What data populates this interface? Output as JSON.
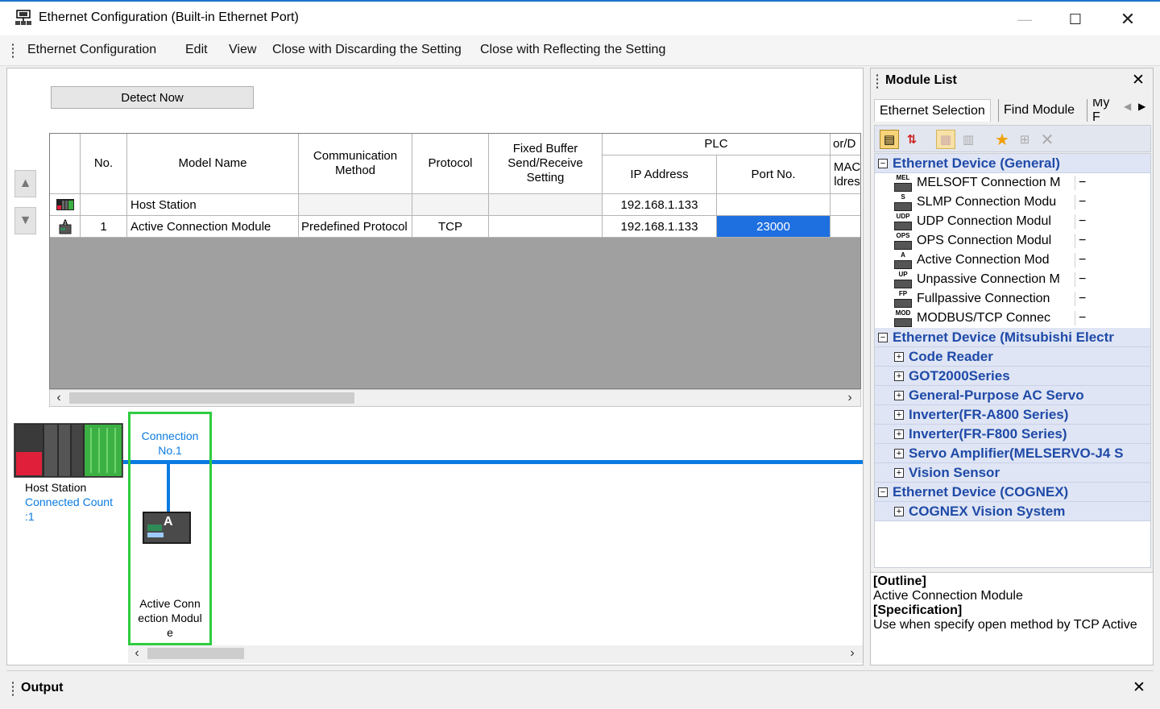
{
  "window": {
    "title": "Ethernet Configuration (Built-in Ethernet Port)",
    "minimize": "—",
    "maximize": "☐",
    "close": "✕"
  },
  "menu": [
    "Ethernet Configuration",
    "Edit",
    "View",
    "Close with Discarding the Setting",
    "Close with Reflecting the Setting"
  ],
  "toolbar": {
    "detect_label": "Detect Now"
  },
  "grid": {
    "headers": {
      "no": "No.",
      "model_name": "Model Name",
      "comm_method": "Communication Method",
      "protocol": "Protocol",
      "fixed_buffer": "Fixed Buffer Send/Receive Setting",
      "plc": "PLC",
      "ip_address": "IP Address",
      "port_no": "Port No.",
      "extra_top": "or/D",
      "extra_bottom": "MAC ldres"
    },
    "rows": [
      {
        "no": "",
        "model_name": "Host Station",
        "comm_method": "",
        "protocol": "",
        "fixed_buffer": "",
        "ip_address": "192.168.1.133",
        "port_no": ""
      },
      {
        "no": "1",
        "model_name": "Active Connection Module",
        "comm_method": "Predefined Protocol",
        "protocol": "TCP",
        "fixed_buffer": "",
        "ip_address": "192.168.1.133",
        "port_no": "23000"
      }
    ]
  },
  "diagram": {
    "host_label": "Host Station",
    "connected_count_label": "Connected Count",
    "connected_count_value": ":1",
    "connection_label": "Connection",
    "connection_no": "No.1",
    "module_label_1": "Active Conn",
    "module_label_2": "ection Modul",
    "module_label_3": "e",
    "module_glyph": "A"
  },
  "module_list": {
    "title": "Module List",
    "tabs": [
      "Ethernet Selection",
      "Find Module",
      "My F"
    ],
    "tree": [
      {
        "type": "cat",
        "expander": "−",
        "label": "Ethernet Device (General)"
      },
      {
        "type": "item",
        "icon": "MEL",
        "label": "MELSOFT Connection M",
        "value": "−"
      },
      {
        "type": "item",
        "icon": "S",
        "label": "SLMP Connection Modu",
        "value": "−"
      },
      {
        "type": "item",
        "icon": "UDP",
        "label": "UDP Connection Modul",
        "value": "−"
      },
      {
        "type": "item",
        "icon": "OPS",
        "label": "OPS Connection Modul",
        "value": "−"
      },
      {
        "type": "item",
        "icon": "A",
        "label": "Active Connection Mod",
        "value": "−"
      },
      {
        "type": "item",
        "icon": "UP",
        "label": "Unpassive Connection M",
        "value": "−"
      },
      {
        "type": "item",
        "icon": "FP",
        "label": "Fullpassive Connection",
        "value": "−"
      },
      {
        "type": "item",
        "icon": "MOD",
        "label": "MODBUS/TCP Connec",
        "value": "−"
      },
      {
        "type": "cat",
        "expander": "−",
        "label": "Ethernet Device (Mitsubishi Electr"
      },
      {
        "type": "subcat",
        "expander": "+",
        "label": "Code Reader"
      },
      {
        "type": "subcat",
        "expander": "+",
        "label": "GOT2000Series"
      },
      {
        "type": "subcat",
        "expander": "+",
        "label": "General-Purpose AC Servo"
      },
      {
        "type": "subcat",
        "expander": "+",
        "label": "Inverter(FR-A800 Series)"
      },
      {
        "type": "subcat",
        "expander": "+",
        "label": "Inverter(FR-F800 Series)"
      },
      {
        "type": "subcat",
        "expander": "+",
        "label": "Servo Amplifier(MELSERVO-J4 S"
      },
      {
        "type": "subcat",
        "expander": "+",
        "label": "Vision Sensor"
      },
      {
        "type": "cat",
        "expander": "−",
        "label": "Ethernet Device (COGNEX)"
      },
      {
        "type": "subcat",
        "expander": "+",
        "label": "COGNEX Vision System"
      }
    ],
    "outline_header": "[Outline]",
    "outline_text": "Active Connection Module",
    "spec_header": "[Specification]",
    "spec_text": "Use when specify open method by TCP Active"
  },
  "output": {
    "title": "Output",
    "close": "✕"
  },
  "colors": {
    "accent": "#1e6fe0",
    "connection_line": "#0a7be0",
    "selection_frame": "#2ecc40"
  }
}
